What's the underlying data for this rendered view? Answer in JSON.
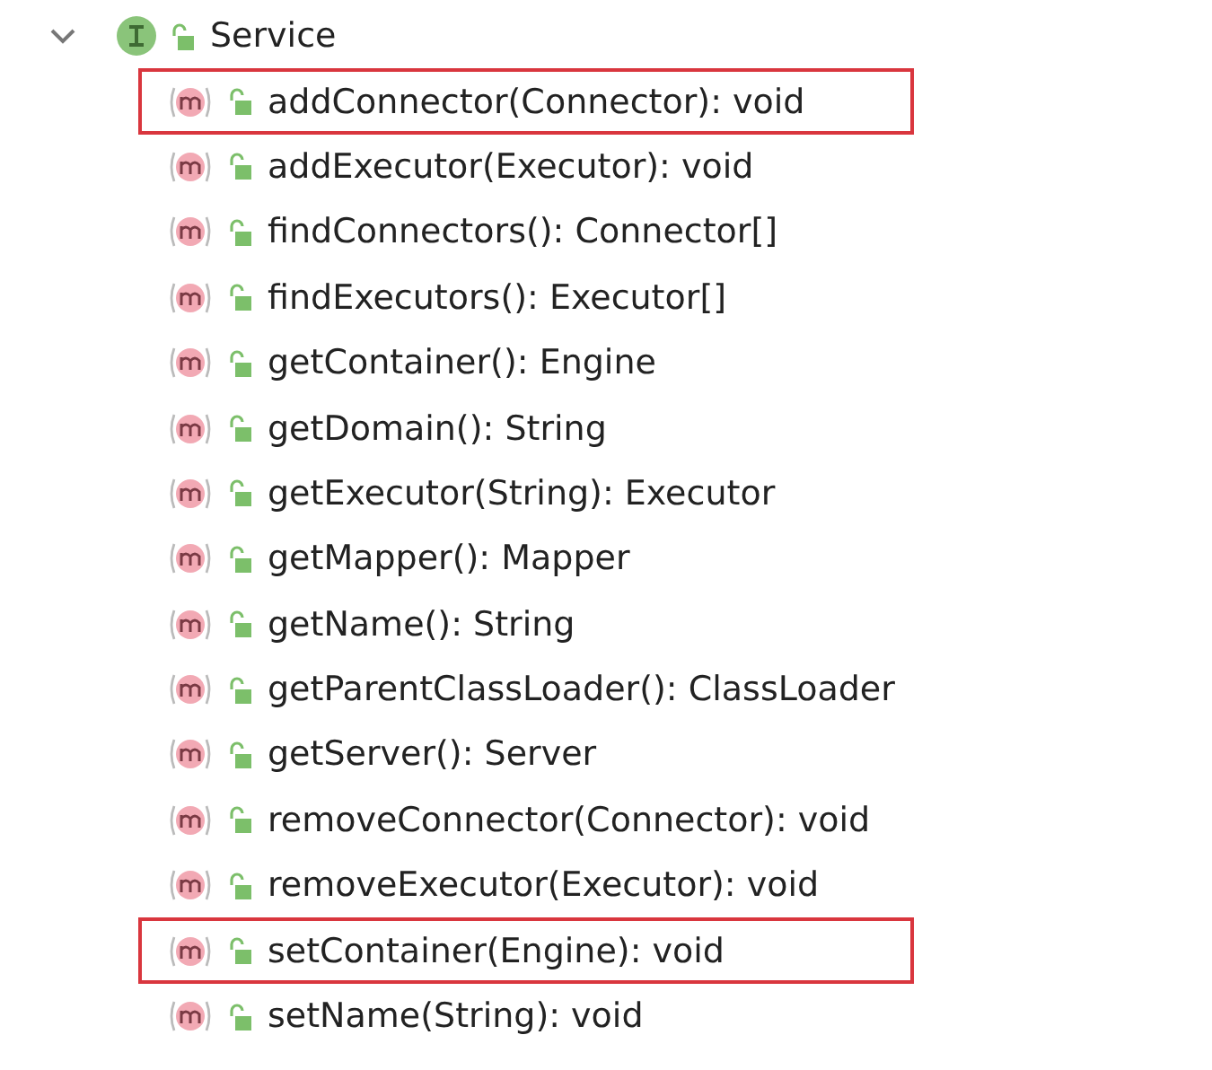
{
  "tree": {
    "label": "Service",
    "expanded": true,
    "children": [
      {
        "label": "addConnector(Connector): void",
        "highlighted": true
      },
      {
        "label": "addExecutor(Executor): void",
        "highlighted": false
      },
      {
        "label": "findConnectors(): Connector[]",
        "highlighted": false
      },
      {
        "label": "findExecutors(): Executor[]",
        "highlighted": false
      },
      {
        "label": "getContainer(): Engine",
        "highlighted": false
      },
      {
        "label": "getDomain(): String",
        "highlighted": false
      },
      {
        "label": "getExecutor(String): Executor",
        "highlighted": false
      },
      {
        "label": "getMapper(): Mapper",
        "highlighted": false
      },
      {
        "label": "getName(): String",
        "highlighted": false
      },
      {
        "label": "getParentClassLoader(): ClassLoader",
        "highlighted": false
      },
      {
        "label": "getServer(): Server",
        "highlighted": false
      },
      {
        "label": "removeConnector(Connector): void",
        "highlighted": false
      },
      {
        "label": "removeExecutor(Executor): void",
        "highlighted": false
      },
      {
        "label": "setContainer(Engine): void",
        "highlighted": true
      },
      {
        "label": "setName(String): void",
        "highlighted": false
      }
    ]
  }
}
